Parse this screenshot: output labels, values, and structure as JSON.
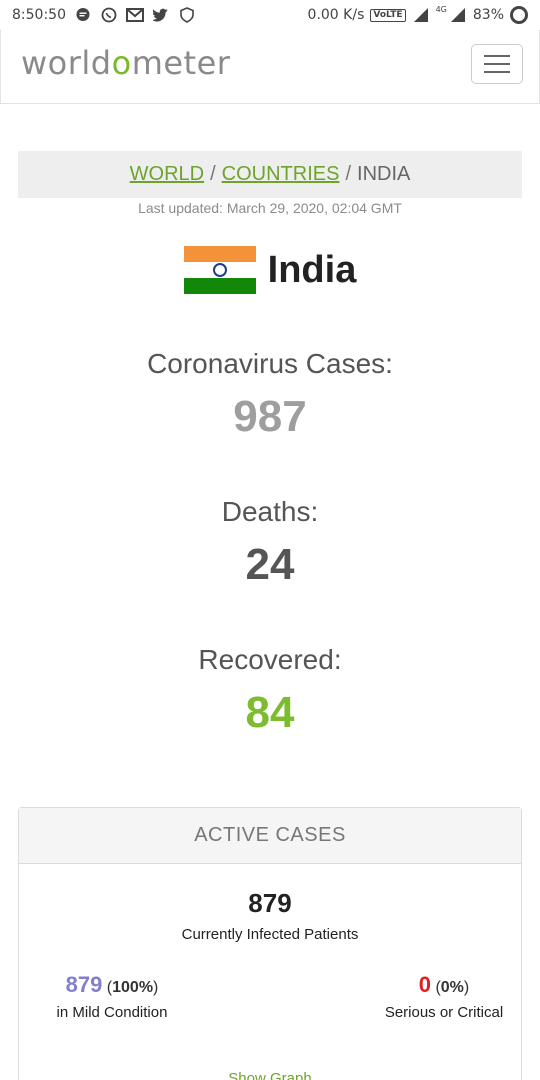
{
  "status_bar": {
    "time": "8:50:50",
    "net_speed": "0.00 K/s",
    "volte": "VoLTE",
    "network": "4G",
    "battery": "83%"
  },
  "header": {
    "logo_left": "world",
    "logo_o": "o",
    "logo_right": "meter",
    "menu_icon": "hamburger-icon"
  },
  "breadcrumb": {
    "world": "WORLD",
    "countries": "COUNTRIES",
    "current": "INDIA",
    "separator": "/"
  },
  "last_updated": "Last updated: March 29, 2020, 02:04 GMT",
  "country": {
    "name": "India",
    "flag_colors": [
      "#f4923a",
      "#ffffff",
      "#138808"
    ]
  },
  "stats": {
    "cases_label": "Coronavirus Cases:",
    "cases_value": "987",
    "deaths_label": "Deaths:",
    "deaths_value": "24",
    "recovered_label": "Recovered:",
    "recovered_value": "84"
  },
  "colors": {
    "cases": "#9e9e9e",
    "deaths": "#555555",
    "recovered": "#7cbc2e",
    "mild": "#8080cc",
    "serious": "#e02020",
    "link": "#6ea32c"
  },
  "active_cases": {
    "title": "ACTIVE CASES",
    "total": "879",
    "total_label": "Currently Infected Patients",
    "mild_value": "879",
    "mild_pct": "100%",
    "mild_label": "in Mild Condition",
    "serious_value": "0",
    "serious_pct": "0%",
    "serious_label": "Serious or Critical",
    "show_graph": "Show Graph"
  }
}
